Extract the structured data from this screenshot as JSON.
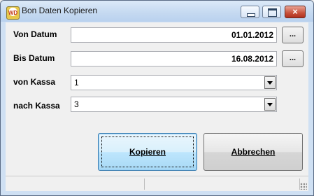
{
  "window": {
    "title": "Bon Daten Kopieren",
    "icon": "wd-app-icon"
  },
  "titlebar": {
    "minimize": "minimize",
    "maximize": "maximize",
    "close": "×"
  },
  "form": {
    "von_datum_label": "Von Datum",
    "von_datum_value": "01.01.2012",
    "bis_datum_label": "Bis Datum",
    "bis_datum_value": "16.08.2012",
    "von_kassa_label": "von Kassa",
    "von_kassa_value": "1",
    "nach_kassa_label": "nach Kassa",
    "nach_kassa_value": "3",
    "picker_label": "..."
  },
  "buttons": {
    "kopieren": "Kopieren",
    "abbrechen": "Abbrechen"
  },
  "colors": {
    "title_gradient_top": "#dce9f8",
    "title_gradient_bottom": "#b9d1ee",
    "close_red": "#c7513a",
    "client_bg": "#f0f0f0"
  }
}
